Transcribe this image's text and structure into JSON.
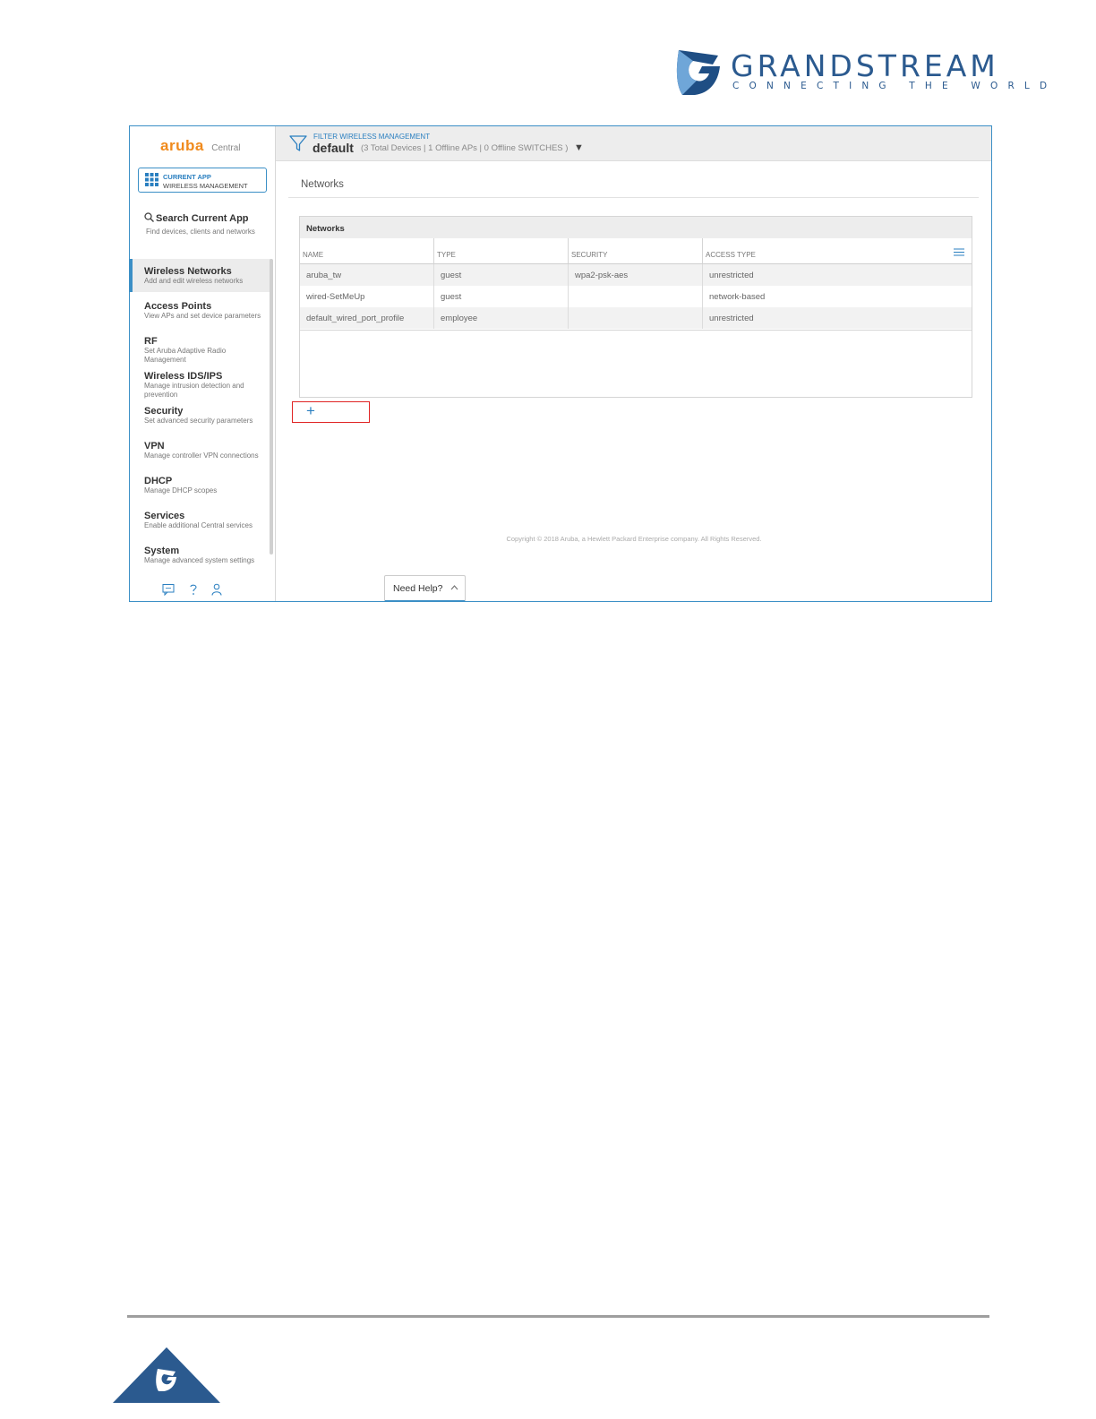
{
  "brand": {
    "name": "GRANDSTREAM",
    "tagline": "CONNECTING THE WORLD",
    "primary_color": "#2b5a8f"
  },
  "app": {
    "logo_word": "aruba",
    "logo_suffix": "Central",
    "current_app_label": "CURRENT APP",
    "current_app_value": "WIRELESS MANAGEMENT",
    "accent_color": "#3b8fc6",
    "logo_color": "#f08a1c"
  },
  "search": {
    "title": "Search Current App",
    "subtitle": "Find devices, clients and networks",
    "icon": "search-icon"
  },
  "nav": [
    {
      "title": "Wireless Networks",
      "desc": "Add and edit wireless networks",
      "active": true
    },
    {
      "title": "Access Points",
      "desc": "View APs and set device parameters"
    },
    {
      "title": "RF",
      "desc": "Set Aruba Adaptive Radio Management"
    },
    {
      "title": "Wireless IDS/IPS",
      "desc": "Manage intrusion detection and prevention"
    },
    {
      "title": "Security",
      "desc": "Set advanced security parameters"
    },
    {
      "title": "VPN",
      "desc": "Manage controller VPN connections"
    },
    {
      "title": "DHCP",
      "desc": "Manage DHCP scopes"
    },
    {
      "title": "Services",
      "desc": "Enable additional Central services"
    },
    {
      "title": "System",
      "desc": "Manage advanced system settings"
    }
  ],
  "sidebar_footer_icons": [
    "chat-icon",
    "help-icon",
    "user-icon"
  ],
  "filter": {
    "label": "FILTER WIRELESS MANAGEMENT",
    "group": "default",
    "stats": "(3 Total Devices | 1 Offline APs | 0 Offline SWITCHES   )",
    "caret": "▼"
  },
  "page": {
    "title": "Networks"
  },
  "table": {
    "title": "Networks",
    "columns": [
      "NAME",
      "TYPE",
      "SECURITY",
      "ACCESS TYPE"
    ],
    "rows": [
      [
        "aruba_tw",
        "guest",
        "wpa2-psk-aes",
        "unrestricted"
      ],
      [
        "wired-SetMeUp",
        "guest",
        "",
        "network-based"
      ],
      [
        "default_wired_port_profile",
        "employee",
        "",
        "unrestricted"
      ]
    ]
  },
  "add_button": {
    "label": "+"
  },
  "copyright": "Copyright © 2018 Aruba, a Hewlett Packard Enterprise company. All Rights Reserved.",
  "help": {
    "label": "Need Help?"
  }
}
